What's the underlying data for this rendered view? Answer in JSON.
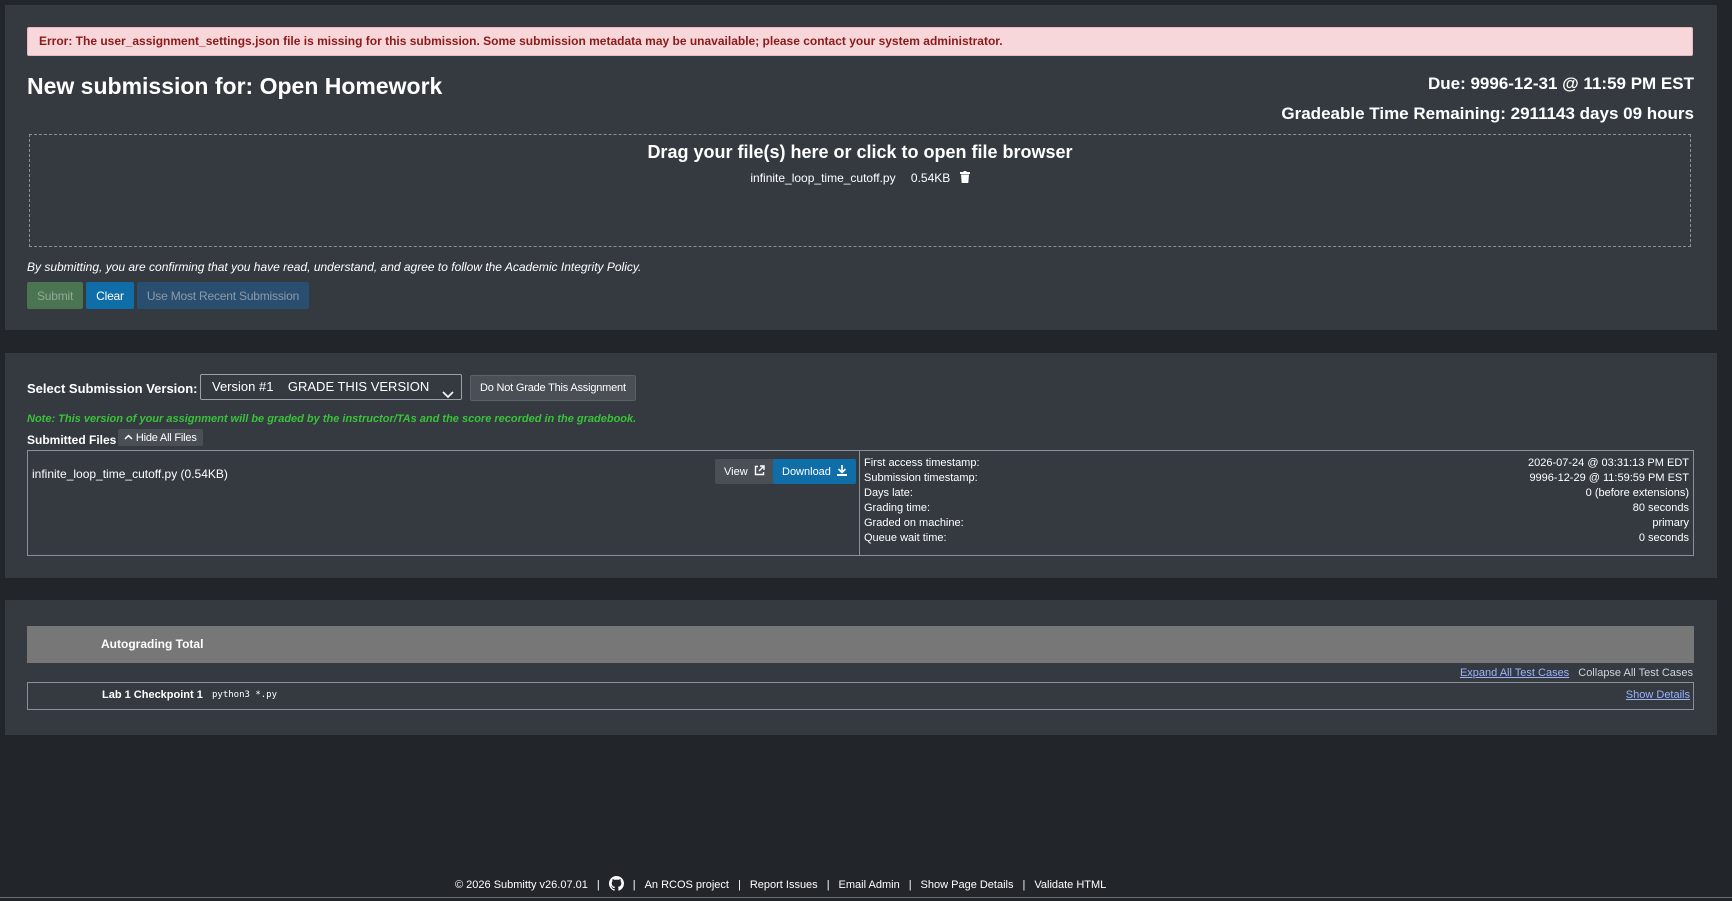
{
  "error_banner": "Error: The user_assignment_settings.json file is missing for this submission. Some submission metadata may be unavailable; please contact your system administrator.",
  "header": {
    "title": "New submission for: Open Homework",
    "due": "Due: 9996-12-31 @ 11:59 PM EST",
    "remaining": "Gradeable Time Remaining: 2911143 days 09 hours"
  },
  "dropzone": {
    "title": "Drag your file(s) here or click to open file browser",
    "file_name": "infinite_loop_time_cutoff.py",
    "file_size": "0.54KB",
    "delete_icon": "trash-icon"
  },
  "agreement": "By submitting, you are confirming that you have read, understand, and agree to follow the Academic Integrity Policy.",
  "buttons": {
    "submit": "Submit",
    "clear": "Clear",
    "recent": "Use Most Recent Submission"
  },
  "version": {
    "label": "Select Submission Version:",
    "selected": "Version #1    GRADE THIS VERSION",
    "no_grade": "Do Not Grade This Assignment",
    "note": "Note: This version of your assignment will be graded by the instructor/TAs and the score recorded in the gradebook."
  },
  "submitted_files": {
    "label": "Submitted Files",
    "hide_button": "Hide All Files",
    "file": "infinite_loop_time_cutoff.py (0.54KB)",
    "view": "View",
    "download": "Download"
  },
  "metadata": [
    {
      "label": "First access timestamp:",
      "value": "2026-07-24 @ 03:31:13 PM EDT"
    },
    {
      "label": "Submission timestamp:",
      "value": "9996-12-29 @ 11:59:59 PM EST"
    },
    {
      "label": "Days late:",
      "value": "0 (before extensions)"
    },
    {
      "label": "Grading time:",
      "value": "80 seconds"
    },
    {
      "label": "Graded on machine:",
      "value": "primary"
    },
    {
      "label": "Queue wait time:",
      "value": "0 seconds"
    }
  ],
  "autograding": {
    "total_label": "Autograding Total",
    "expand_all": "Expand All Test Cases",
    "collapse_all": "Collapse All Test Cases",
    "testcase_name": "Lab 1 Checkpoint 1",
    "testcase_command": "python3 *.py",
    "show_details": "Show Details"
  },
  "footer": {
    "copyright": "© 2026 Submitty v26.07.01",
    "rcos": "An RCOS project",
    "report": "Report Issues",
    "email": "Email Admin",
    "details": "Show Page Details",
    "validate": "Validate HTML"
  },
  "colors": {
    "page_bg": "#22252a",
    "panel_bg": "#343a40",
    "error_bg": "#f8d7da",
    "primary_blue": "#0f6ea8",
    "note_green": "#3ac23a"
  }
}
